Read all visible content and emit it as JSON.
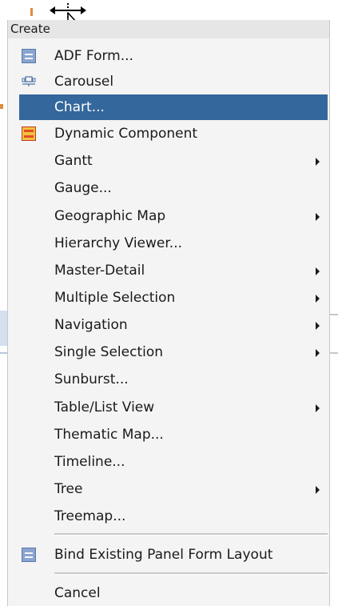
{
  "menu": {
    "header": "Create",
    "items": [
      {
        "label": "ADF Form...",
        "icon": "form-icon",
        "submenu": false
      },
      {
        "label": "Carousel",
        "icon": "carousel-icon",
        "submenu": false
      },
      {
        "label": "Chart...",
        "icon": "",
        "submenu": false,
        "highlighted": true
      },
      {
        "label": "Dynamic Component",
        "icon": "dynamic-component-icon",
        "submenu": false
      },
      {
        "label": "Gantt",
        "icon": "",
        "submenu": true
      },
      {
        "label": "Gauge...",
        "icon": "",
        "submenu": false
      },
      {
        "label": "Geographic Map",
        "icon": "",
        "submenu": true
      },
      {
        "label": "Hierarchy Viewer...",
        "icon": "",
        "submenu": false
      },
      {
        "label": "Master-Detail",
        "icon": "",
        "submenu": true
      },
      {
        "label": "Multiple Selection",
        "icon": "",
        "submenu": true
      },
      {
        "label": "Navigation",
        "icon": "",
        "submenu": true
      },
      {
        "label": "Single Selection",
        "icon": "",
        "submenu": true
      },
      {
        "label": "Sunburst...",
        "icon": "",
        "submenu": false
      },
      {
        "label": "Table/List View",
        "icon": "",
        "submenu": true
      },
      {
        "label": "Thematic Map...",
        "icon": "",
        "submenu": false
      },
      {
        "label": "Timeline...",
        "icon": "",
        "submenu": false
      },
      {
        "label": "Tree",
        "icon": "",
        "submenu": true
      },
      {
        "label": "Treemap...",
        "icon": "",
        "submenu": false
      }
    ],
    "bind_item": {
      "label": "Bind Existing Panel Form Layout",
      "icon": "form-icon"
    },
    "cancel_item": {
      "label": "Cancel"
    }
  },
  "colors": {
    "highlight": "#34679c",
    "menu_bg": "#f4f4f4",
    "header_bg": "#e6e6e6"
  }
}
